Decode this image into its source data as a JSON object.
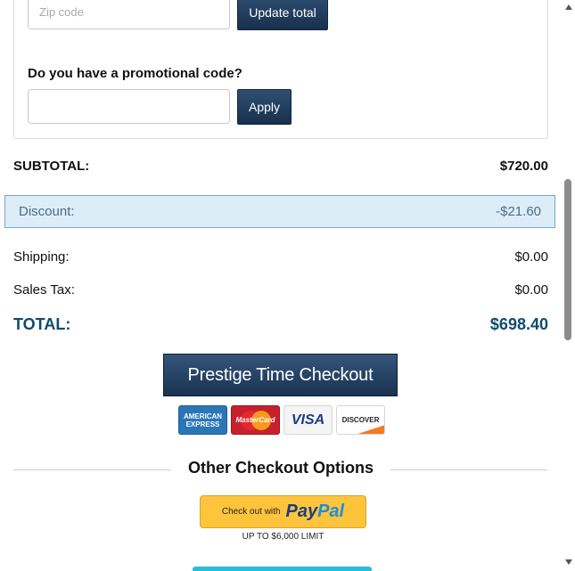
{
  "shipping_form": {
    "zip_placeholder": "Zip code",
    "update_label": "Update total"
  },
  "promo": {
    "question": "Do you have a promotional code?",
    "input_value": "",
    "apply_label": "Apply"
  },
  "totals": {
    "subtotal_label": "SUBTOTAL:",
    "subtotal_value": "$720.00",
    "discount_label": "Discount:",
    "discount_value": "-$21.60",
    "shipping_label": "Shipping:",
    "shipping_value": "$0.00",
    "tax_label": "Sales Tax:",
    "tax_value": "$0.00",
    "total_label": "TOTAL:",
    "total_value": "$698.40"
  },
  "checkout": {
    "button_label": "Prestige Time Checkout",
    "cards": {
      "amex": "AMERICAN EXPRESS",
      "mastercard": "MasterCard",
      "visa": "VISA",
      "discover": "DISCOVER"
    }
  },
  "other_options": {
    "title": "Other Checkout Options",
    "paypal_prefix": "Check out with",
    "paypal_logo_pay": "Pay",
    "paypal_logo_pal": "Pal",
    "paypal_limit": "UP TO $6,000 LIMIT"
  },
  "colors": {
    "accent_dark_blue": "#1a3351",
    "total_blue": "#0f4a70",
    "discount_bg": "#dcedf8",
    "paypal_yellow": "#fec43b",
    "next_button_teal": "#22c0d9"
  }
}
